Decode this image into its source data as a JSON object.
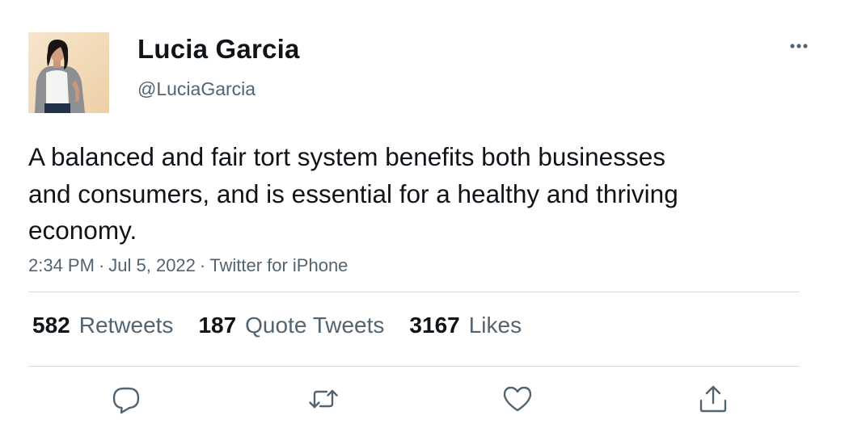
{
  "user": {
    "display_name": "Lucia Garcia",
    "handle": "@LuciaGarcia"
  },
  "tweet": {
    "text": "A balanced and fair tort system benefits both businesses and consumers, and is essential for a healthy and thriving economy.",
    "time": "2:34 PM",
    "date": "Jul 5, 2022",
    "source": "Twitter for iPhone",
    "separator": "·"
  },
  "stats": {
    "retweets": {
      "count": "582",
      "label": "Retweets"
    },
    "quote_tweets": {
      "count": "187",
      "label": "Quote Tweets"
    },
    "likes": {
      "count": "3167",
      "label": "Likes"
    }
  },
  "icons": {
    "more": "more-horizontal-icon",
    "reply": "reply-icon",
    "retweet": "retweet-icon",
    "like": "heart-icon",
    "share": "share-icon"
  },
  "colors": {
    "text_primary": "#0f1419",
    "text_secondary": "#536471",
    "divider": "#cfd9de",
    "icon": "#536471"
  }
}
